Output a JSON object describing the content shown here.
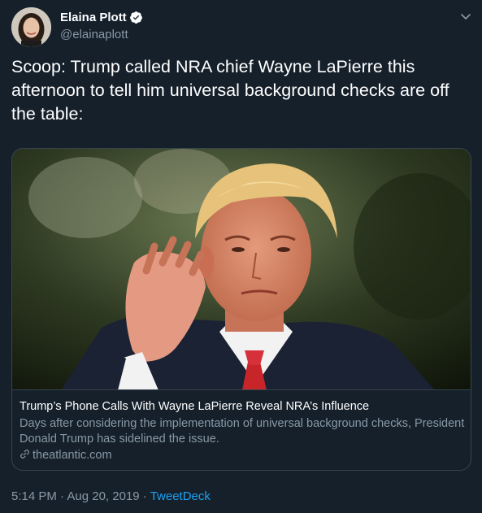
{
  "author": {
    "name": "Elaina Plott",
    "handle": "@elainaplott",
    "verified": true
  },
  "tweet": {
    "text": "Scoop: Trump called NRA chief Wayne LaPierre this afternoon to tell him universal background checks are off the table:"
  },
  "card": {
    "title": "Trump’s Phone Calls With Wayne LaPierre Reveal NRA’s Influence",
    "description": "Days after considering the implementation of universal background checks, President Donald Trump has sidelined the issue.",
    "domain": "theatlantic.com",
    "domain_icon": "link-icon"
  },
  "meta": {
    "time": "5:14 PM",
    "separator1": " · ",
    "date": "Aug 20, 2019",
    "separator2": " · ",
    "source": "TweetDeck"
  },
  "icons": {
    "verified": "verified-badge-icon",
    "caret": "chevron-down-icon"
  },
  "colors": {
    "background": "#15202b",
    "secondary_text": "#8899a6",
    "accent": "#1da1f2",
    "border": "#38444d"
  }
}
